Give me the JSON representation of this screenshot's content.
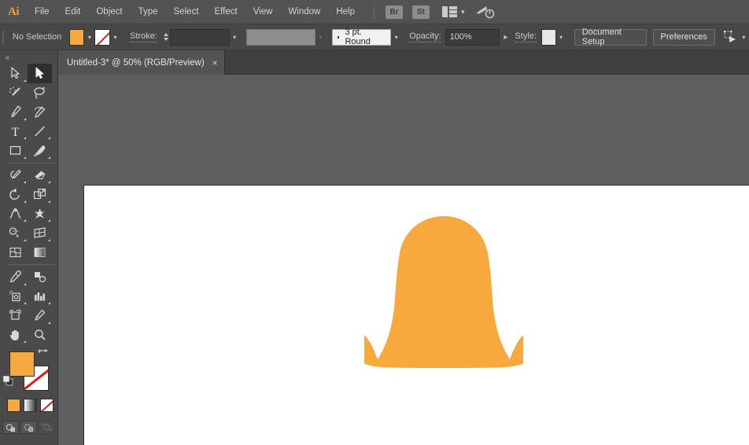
{
  "app": {
    "name": "Adobe Illustrator",
    "logo_text": "Ai",
    "accent_color": "#f79d3c"
  },
  "menubar": {
    "items": [
      {
        "label": "File"
      },
      {
        "label": "Edit"
      },
      {
        "label": "Object"
      },
      {
        "label": "Type"
      },
      {
        "label": "Select"
      },
      {
        "label": "Effect"
      },
      {
        "label": "View"
      },
      {
        "label": "Window"
      },
      {
        "label": "Help"
      }
    ],
    "bridge_label": "Br",
    "stock_label": "St",
    "arrange_icon": "arrange-documents-icon",
    "search_icon": "search-home-icon"
  },
  "controlbar": {
    "selection_status": "No Selection",
    "fill_color": "#f5a93f",
    "stroke_color": "none",
    "stroke_label": "Stroke:",
    "stroke_weight": "",
    "stroke_profile": "3 pt. Round",
    "opacity_label": "Opacity:",
    "opacity_value": "100%",
    "style_label": "Style:",
    "style_color": "#e8e8e8",
    "document_setup_label": "Document Setup",
    "preferences_label": "Preferences",
    "align_icon": "align-transform-icon"
  },
  "tab": {
    "title": "Untitled-3* @ 50% (RGB/Preview)",
    "close_label": "×",
    "document_name": "Untitled-3",
    "zoom_level": "50%",
    "color_mode": "RGB",
    "view_mode": "Preview",
    "modified": true
  },
  "toolbar": {
    "collapse_label": "«",
    "tools": [
      {
        "name": "direct-selection-tool",
        "active": false,
        "has_flyout": true
      },
      {
        "name": "selection-tool",
        "active": true,
        "has_flyout": false
      },
      {
        "name": "magic-wand-tool",
        "active": false,
        "has_flyout": false
      },
      {
        "name": "lasso-tool",
        "active": false,
        "has_flyout": false
      },
      {
        "name": "pen-tool",
        "active": false,
        "has_flyout": true
      },
      {
        "name": "curvature-tool",
        "active": false,
        "has_flyout": false
      },
      {
        "name": "type-tool",
        "active": false,
        "has_flyout": true
      },
      {
        "name": "line-segment-tool",
        "active": false,
        "has_flyout": true
      },
      {
        "name": "rectangle-tool",
        "active": false,
        "has_flyout": true
      },
      {
        "name": "paintbrush-tool",
        "active": false,
        "has_flyout": true
      },
      {
        "name": "shaper-pencil-tool",
        "active": false,
        "has_flyout": true
      },
      {
        "name": "eraser-tool",
        "active": false,
        "has_flyout": true
      },
      {
        "name": "rotate-tool",
        "active": false,
        "has_flyout": true
      },
      {
        "name": "scale-tool",
        "active": false,
        "has_flyout": true
      },
      {
        "name": "width-tool",
        "active": false,
        "has_flyout": true
      },
      {
        "name": "free-transform-tool",
        "active": false,
        "has_flyout": true
      },
      {
        "name": "shape-builder-tool",
        "active": false,
        "has_flyout": true
      },
      {
        "name": "perspective-grid-tool",
        "active": false,
        "has_flyout": true
      },
      {
        "name": "mesh-tool",
        "active": false,
        "has_flyout": false
      },
      {
        "name": "gradient-tool",
        "active": false,
        "has_flyout": false
      },
      {
        "name": "eyedropper-tool",
        "active": false,
        "has_flyout": true
      },
      {
        "name": "blend-tool",
        "active": false,
        "has_flyout": false
      },
      {
        "name": "symbol-sprayer-tool",
        "active": false,
        "has_flyout": true
      },
      {
        "name": "column-graph-tool",
        "active": false,
        "has_flyout": true
      },
      {
        "name": "artboard-tool",
        "active": false,
        "has_flyout": false
      },
      {
        "name": "slice-tool",
        "active": false,
        "has_flyout": true
      },
      {
        "name": "hand-tool",
        "active": false,
        "has_flyout": true
      },
      {
        "name": "zoom-tool",
        "active": false,
        "has_flyout": false
      }
    ],
    "fill_color": "#f5a93f",
    "stroke_color": "none",
    "swap_icon": "swap-fill-stroke-icon",
    "default_icon": "default-fill-stroke-icon",
    "fill_modes": [
      {
        "name": "color-button",
        "color": "#f5a93f"
      },
      {
        "name": "gradient-button",
        "color": "gradient"
      },
      {
        "name": "none-button",
        "color": "none"
      }
    ],
    "screen_modes": [
      {
        "name": "draw-normal-button",
        "enabled": true
      },
      {
        "name": "draw-behind-button",
        "enabled": true
      },
      {
        "name": "draw-inside-button",
        "enabled": false
      }
    ]
  },
  "canvas": {
    "background_color": "#5e5e5e",
    "artboard_color": "#ffffff",
    "artwork": {
      "name": "bell-shape-path",
      "fill": "#f7a93e",
      "description": "Bell / dress shaped vector path with rounded dome top, tapered waist and flared skirt"
    }
  }
}
